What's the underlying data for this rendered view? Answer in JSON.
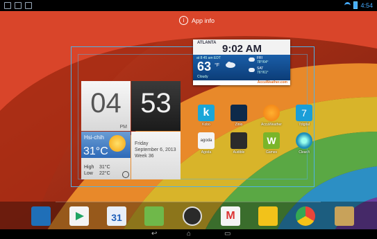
{
  "status_bar": {
    "time": "4:54",
    "left_icons": [
      "notification-icon",
      "image-icon",
      "download-icon"
    ],
    "right_icons": [
      "wifi-icon",
      "battery-icon"
    ]
  },
  "app_info": {
    "label": "App info"
  },
  "weather_widget": {
    "city": "ATLANTA",
    "time": "9:02 AM",
    "as_of": "at 8:45 am EDT",
    "temperature": "63",
    "unit": "°F",
    "condition": "Cloudy",
    "forecast": [
      {
        "day": "FRI",
        "hilo": "78°/64°"
      },
      {
        "day": "SAT",
        "hilo": "76°/61°"
      }
    ],
    "brand": "AccuWeather.com"
  },
  "clock_widget": {
    "hours": "04",
    "minutes": "53",
    "ampm": "PM"
  },
  "weather_small": {
    "city": "Hsi-chih",
    "temperature": "31°C",
    "high_label": "High",
    "high_value": "31°C",
    "low_label": "Low",
    "low_value": "22°C"
  },
  "calendar_widget": {
    "day": "Friday",
    "date": "September 6, 2013",
    "week": "Week 36"
  },
  "apps": [
    {
      "label": "Kobo",
      "icon": "kobo-icon",
      "color": "#1aa6d8"
    },
    {
      "label": "Zinio",
      "icon": "zinio-icon",
      "color": "#0e2a4a"
    },
    {
      "label": "AccuWeather",
      "icon": "accuweather-icon",
      "color": "#f07a10"
    },
    {
      "label": "7digital",
      "icon": "7digital-icon",
      "color": "#1a9ed8"
    },
    {
      "label": "Agoda",
      "icon": "agoda-icon",
      "color": "#f4f4f4"
    },
    {
      "label": "Audible",
      "icon": "audible-icon",
      "color": "#2b2b2b"
    },
    {
      "label": "Games",
      "icon": "games-icon",
      "color": "#7ab52a"
    },
    {
      "label": "Clear.fi",
      "icon": "clearfi-icon",
      "color": "#1e8fb8"
    }
  ],
  "dock": [
    {
      "icon": "dolby-icon",
      "color": "#1f6fb8"
    },
    {
      "icon": "play-store-icon",
      "color": "#f4f4f4"
    },
    {
      "icon": "calendar-icon",
      "color": "#e8eef8"
    },
    {
      "icon": "maps-icon",
      "color": "#6fb84a"
    },
    {
      "icon": "all-apps-icon",
      "color": "#2a2a2a"
    },
    {
      "icon": "gmail-icon",
      "color": "#f4f4f4"
    },
    {
      "icon": "gallery-icon",
      "color": "#f2c21a"
    },
    {
      "icon": "chrome-icon",
      "color": "#e8453a"
    },
    {
      "icon": "camera-icon",
      "color": "#c8a25a"
    }
  ],
  "dock_calendar_day": "31",
  "nav": {
    "back": "back-icon",
    "home": "home-icon",
    "recents": "recents-icon"
  }
}
